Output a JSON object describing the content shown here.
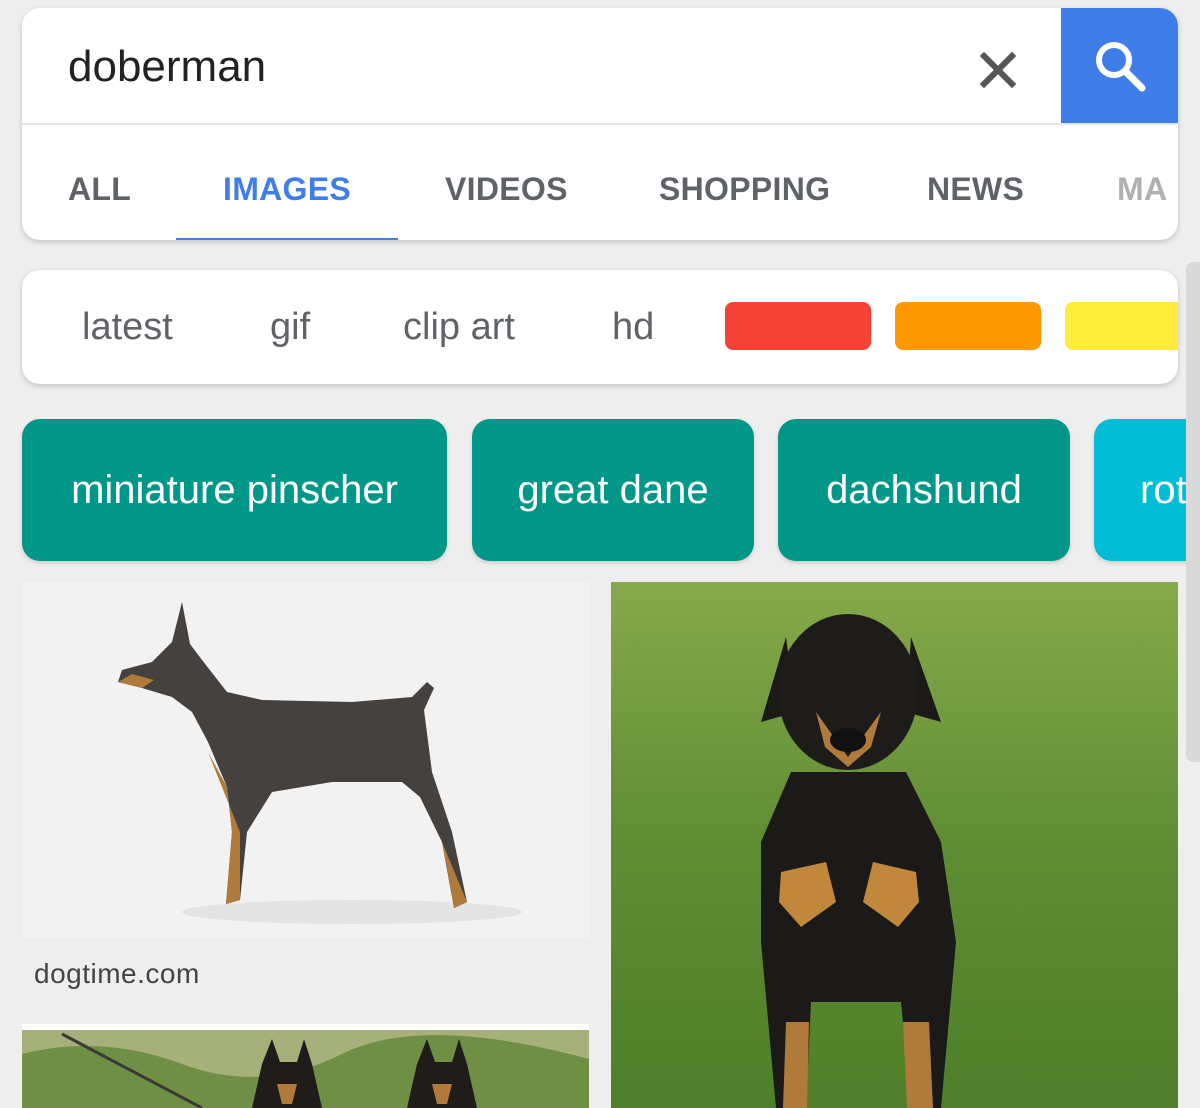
{
  "search": {
    "query": "doberman"
  },
  "tabs": [
    "ALL",
    "IMAGES",
    "VIDEOS",
    "SHOPPING",
    "NEWS",
    "MA"
  ],
  "active_tab": "IMAGES",
  "filters": [
    "latest",
    "gif",
    "clip art",
    "hd"
  ],
  "color_filters": [
    "#f44336",
    "#ff9800",
    "#ffeb3b"
  ],
  "related": [
    "miniature pinscher",
    "great dane",
    "dachshund",
    "rott"
  ],
  "results": [
    {
      "source": "dogtime.com"
    }
  ],
  "colors": {
    "accent": "#3f7ee8",
    "chip_teal": "#009688",
    "chip_cyan": "#00bcd4"
  }
}
